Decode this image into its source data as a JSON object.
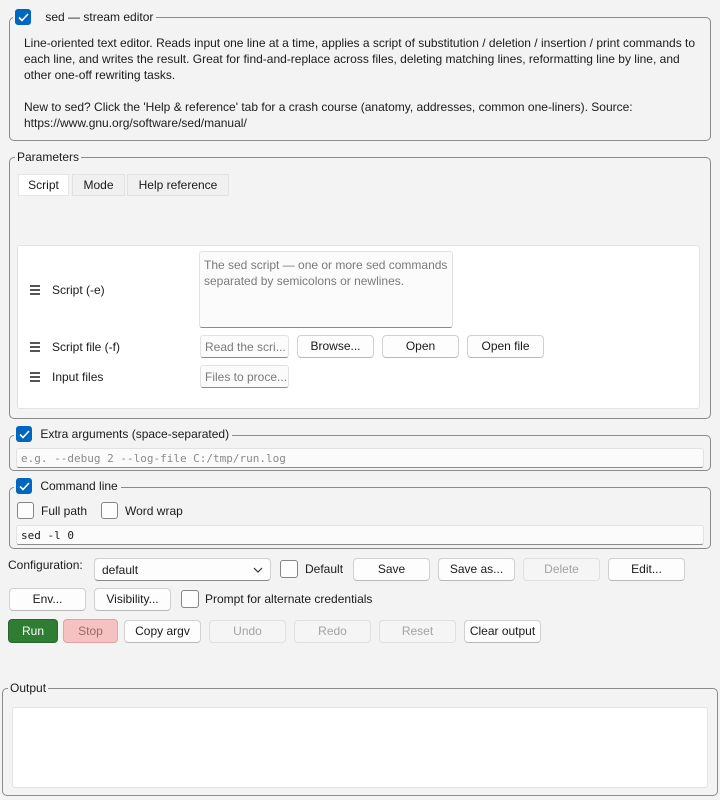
{
  "tool": {
    "title": "sed — stream editor",
    "enabled": true,
    "description": "Line-oriented text editor. Reads input one line at a time, applies a script of substitution / deletion / insertion / print commands to each line, and writes the result. Great for find-and-replace across files, deleting matching lines, reformatting line by line, and other one-off rewriting tasks.",
    "help_note": "New to sed? Click the 'Help & reference' tab for a crash course (anatomy, addresses, common one-liners). Source: https://www.gnu.org/software/sed/manual/"
  },
  "parameters": {
    "legend": "Parameters",
    "tabs": [
      {
        "label": "Script",
        "active": true
      },
      {
        "label": "Mode",
        "active": false
      },
      {
        "label": "Help  reference",
        "active": false
      }
    ],
    "script": {
      "label": "Script (-e)",
      "placeholder": "The sed script — one or more sed commands separated by semicolons or newlines."
    },
    "script_file": {
      "label": "Script file (-f)",
      "placeholder": "Read the scri...",
      "browse_label": "Browse...",
      "open_label": "Open",
      "open_file_label": "Open file"
    },
    "input_files": {
      "label": "Input files",
      "placeholder": "Files to proce..."
    }
  },
  "extra_args": {
    "label": "Extra arguments (space-separated)",
    "enabled": true,
    "placeholder": "e.g. --debug 2 --log-file C:/tmp/run.log"
  },
  "command_line": {
    "label": "Command line",
    "enabled": true,
    "full_path_label": "Full path",
    "full_path_checked": false,
    "word_wrap_label": "Word wrap",
    "word_wrap_checked": false,
    "value": "sed -l 0"
  },
  "configuration": {
    "label": "Configuration:",
    "selected": "default",
    "default_label": "Default",
    "default_checked": false,
    "save_label": "Save",
    "save_as_label": "Save as...",
    "delete_label": "Delete",
    "edit_label": "Edit..."
  },
  "options": {
    "env_label": "Env...",
    "visibility_label": "Visibility...",
    "prompt_label": "Prompt for alternate credentials",
    "prompt_checked": false
  },
  "actions": {
    "run_label": "Run",
    "stop_label": "Stop",
    "copy_argv_label": "Copy argv",
    "undo_label": "Undo",
    "redo_label": "Redo",
    "reset_label": "Reset",
    "clear_output_label": "Clear output"
  },
  "output": {
    "legend": "Output",
    "text": ""
  },
  "icons": {
    "checkmark": "checkmark-icon",
    "drag_handle": "drag-handle-icon",
    "dropdown": "chevron-down-icon"
  },
  "colors": {
    "accent": "#0067c0",
    "run": "#2e7d32",
    "stop": "#f6c1c1"
  }
}
